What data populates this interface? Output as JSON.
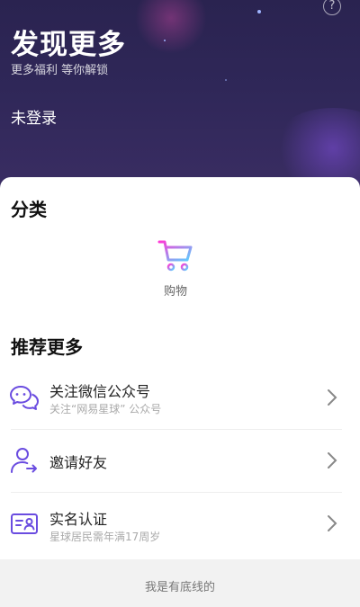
{
  "hero": {
    "title": "发现更多",
    "subtitle": "更多福利 等你解锁",
    "login_status": "未登录",
    "help_glyph": "?"
  },
  "categories": {
    "title": "分类",
    "items": [
      {
        "label": "购物",
        "icon": "cart-icon"
      }
    ]
  },
  "recommend": {
    "title": "推荐更多",
    "items": [
      {
        "title": "关注微信公众号",
        "subtitle": "关注“网易星球” 公众号",
        "icon": "wechat-icon"
      },
      {
        "title": "邀请好友",
        "subtitle": "",
        "icon": "invite-user-icon"
      },
      {
        "title": "实名认证",
        "subtitle": "星球居民需年满17周岁",
        "icon": "id-card-icon"
      }
    ]
  },
  "footer": {
    "text": "我是有底线的"
  },
  "colors": {
    "accent": "#6a4ce0",
    "hero_bg": "#2f2758",
    "cart_gradient": [
      "#ff3ad6",
      "#5ad0ff"
    ]
  }
}
